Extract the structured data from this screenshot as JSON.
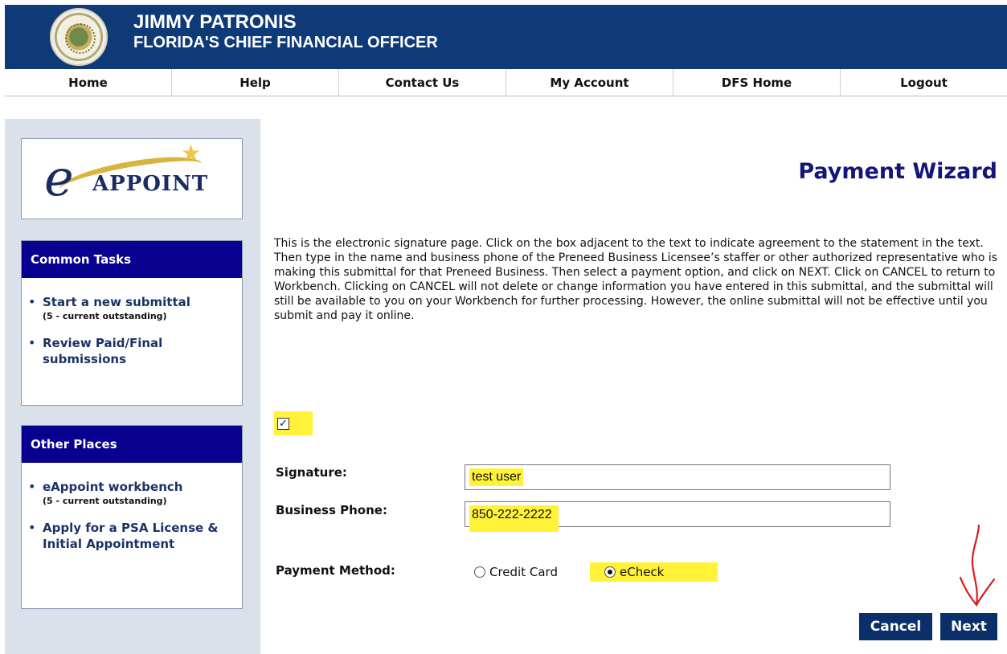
{
  "header": {
    "name": "JIMMY PATRONIS",
    "office": "FLORIDA'S CHIEF FINANCIAL OFFICER"
  },
  "nav": {
    "home": "Home",
    "help": "Help",
    "contact": "Contact Us",
    "account": "My Account",
    "dfs_home": "DFS Home",
    "logout": "Logout"
  },
  "logo": {
    "mark": "e",
    "text": "APPOINT"
  },
  "sidebar": {
    "common_tasks": {
      "title": "Common Tasks",
      "items": [
        {
          "label": "Start a new submittal",
          "sub": "(5 - current outstanding)"
        },
        {
          "label": "Review Paid/Final submissions"
        }
      ]
    },
    "other_places": {
      "title": "Other Places",
      "items": [
        {
          "label": "eAppoint workbench",
          "sub": "(5 - current outstanding)"
        },
        {
          "label": "Apply for a PSA License & Initial Appointment"
        }
      ]
    }
  },
  "main": {
    "title": "Payment Wizard",
    "instructions": "This is the electronic signature page. Click on the box adjacent to the text to indicate agreement to the statement in the text. Then type in the name and business phone of the Preneed Business Licensee’s staffer or other authorized representative who is making this submittal for that Preneed Business. Then select a payment option, and click on NEXT. Click on CANCEL to return to Workbench. Clicking on CANCEL will not delete or change information you have entered in this submittal, and the submittal will still be available to you on your Workbench for further processing. However, the online submittal will not be effective until you submit and pay it online.",
    "agreement_mark": "✓",
    "signature_label": "Signature:",
    "signature_value": "test user",
    "phone_label": "Business Phone:",
    "phone_value": "850-222-2222",
    "payment_label": "Payment Method:",
    "payment_options": [
      "Credit Card",
      "eCheck"
    ],
    "selected_payment": "eCheck",
    "cancel_label": "Cancel",
    "next_label": "Next"
  },
  "colors": {
    "header_blue": "#0e3a78",
    "sidebar_bg": "#dbe1eb",
    "box_header": "#08008f",
    "highlight": "#fff238",
    "button_blue": "#0b2f69",
    "annotation_red": "#d71d1d"
  },
  "icons": {
    "seal": "state-seal-icon",
    "logo": "eappoint-logo",
    "star": "star-icon",
    "check": "checkmark-icon",
    "radio": "radio-button-icon",
    "arrow": "red-arrow-annotation"
  }
}
